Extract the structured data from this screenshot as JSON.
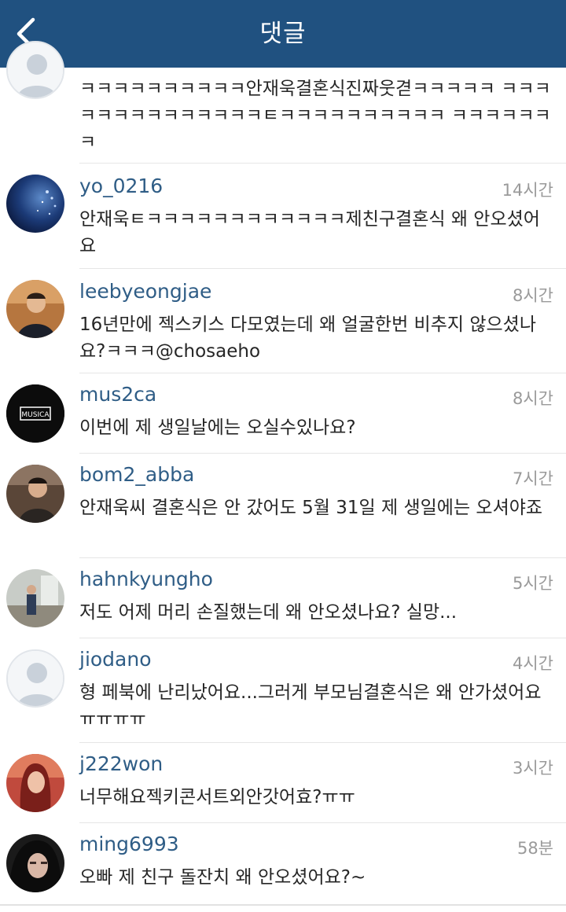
{
  "header": {
    "title": "댓글"
  },
  "comments": [
    {
      "username": "",
      "time": "",
      "text": "ㅋㅋㅋㅋㅋㅋㅋㅋㅋㅋ안재욱결혼식진짜웃겯ㅋㅋㅋㅋㅋ ㅋㅋㅋㅋㅋㅋㅋㅋㅋㅋㅋㅋㅋㅋㅌㅋㅋㅋㅋㅋㅋㅋㅋㅋㅋ ㅋㅋㅋㅋㅋㅋㅋ"
    },
    {
      "username": "yo_0216",
      "time": "14시간",
      "text": "안재욱ㅌㅋㅋㅋㅋㅋㅋㅋㅋㅋㅋㅋㅋ제친구결혼식 왜 안오셨어요"
    },
    {
      "username": "leebyeongjae",
      "time": "8시간",
      "text": "16년만에 젝스키스 다모였는데 왜 얼굴한번 비추지 않으셨나요?ㅋㅋㅋ@chosaeho"
    },
    {
      "username": "mus2ca",
      "time": "8시간",
      "text": "이번에 제 생일날에는 오실수있나요?",
      "avatar_text": "MUSICA"
    },
    {
      "username": "bom2_abba",
      "time": "7시간",
      "text": "안재욱씨 결혼식은 안 갔어도 5월 31일 제 생일에는 오셔야죠"
    },
    {
      "username": "hahnkyungho",
      "time": "5시간",
      "text": "저도 어제 머리 손질했는데 왜 안오셨나요? 실망..."
    },
    {
      "username": "jiodano",
      "time": "4시간",
      "text": "형 페북에 난리났어요...그러게 부모님결혼식은 왜 안가셨어요ㅠㅠㅠㅠ"
    },
    {
      "username": "j222won",
      "time": "3시간",
      "text": "너무해요젝키콘서트외안갓어효?ㅠㅠ"
    },
    {
      "username": "ming6993",
      "time": "58분",
      "text": "오빠 제 친구 돌잔치 왜 안오셨어요?~"
    }
  ],
  "colors": {
    "header": "#205180",
    "username": "#2f5d86",
    "time": "#9a9a9a"
  }
}
